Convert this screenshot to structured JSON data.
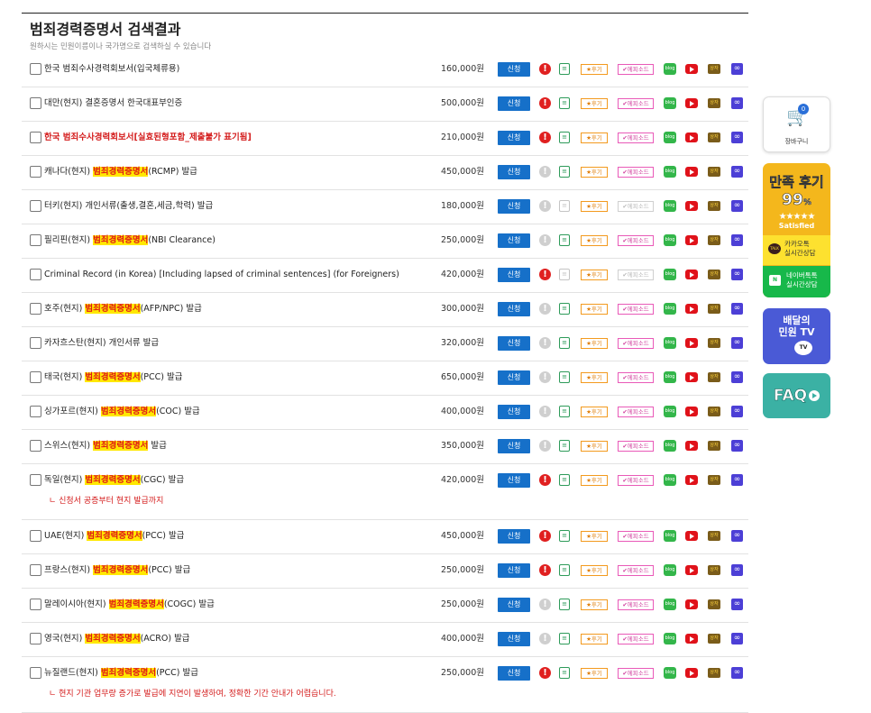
{
  "header": {
    "title": "범죄경력증명서 검색결과",
    "subtitle": "원하시는 민원이름이나 국가명으로 검색하실 수 있습니다"
  },
  "labels": {
    "apply": "신청",
    "review": "★후기",
    "episode": "✔에피소드",
    "blog": "blog",
    "box": "상자",
    "doc": "≡"
  },
  "rows": [
    {
      "pre": "한국 범죄수사경력회보서(입국체류용)",
      "hl": "",
      "post": "",
      "price": "160,000원",
      "red": false,
      "warn_on": true,
      "doc_on": true,
      "episode_on": true,
      "note": ""
    },
    {
      "pre": "대만(현지) 결혼증명서 한국대표부인증",
      "hl": "",
      "post": "",
      "price": "500,000원",
      "red": false,
      "warn_on": true,
      "doc_on": true,
      "episode_on": true,
      "note": ""
    },
    {
      "pre": "한국 범죄수사경력회보서[실효된형포함_제출불가 표기됨]",
      "hl": "",
      "post": "",
      "price": "210,000원",
      "red": true,
      "warn_on": true,
      "doc_on": true,
      "episode_on": true,
      "note": ""
    },
    {
      "pre": "캐나다(현지) ",
      "hl": "범죄경력증명서",
      "post": "(RCMP) 발급",
      "price": "450,000원",
      "red": false,
      "warn_on": false,
      "doc_on": true,
      "episode_on": true,
      "note": ""
    },
    {
      "pre": "터키(현지) 개인서류(출생,결혼,세금,학력) 발급",
      "hl": "",
      "post": "",
      "price": "180,000원",
      "red": false,
      "warn_on": false,
      "doc_on": false,
      "episode_on": false,
      "note": ""
    },
    {
      "pre": "필리핀(현지) ",
      "hl": "범죄경력증명서",
      "post": "(NBI Clearance)",
      "price": "250,000원",
      "red": false,
      "warn_on": false,
      "doc_on": true,
      "episode_on": true,
      "note": ""
    },
    {
      "pre": "Criminal Record (in Korea) [Including lapsed of criminal sentences] (for Foreigners)",
      "hl": "",
      "post": "",
      "price": "420,000원",
      "red": false,
      "warn_on": true,
      "doc_on": false,
      "episode_on": false,
      "note": ""
    },
    {
      "pre": "호주(현지) ",
      "hl": "범죄경력증명서",
      "post": "(AFP/NPC) 발급",
      "price": "300,000원",
      "red": false,
      "warn_on": false,
      "doc_on": true,
      "episode_on": true,
      "note": ""
    },
    {
      "pre": "카자흐스탄(현지) 개인서류 발급",
      "hl": "",
      "post": "",
      "price": "320,000원",
      "red": false,
      "warn_on": false,
      "doc_on": true,
      "episode_on": true,
      "note": ""
    },
    {
      "pre": "태국(현지) ",
      "hl": "범죄경력증명서",
      "post": "(PCC) 발급",
      "price": "650,000원",
      "red": false,
      "warn_on": false,
      "doc_on": true,
      "episode_on": true,
      "note": ""
    },
    {
      "pre": "싱가포르(현지) ",
      "hl": "범죄경력증명서",
      "post": "(COC) 발급",
      "price": "400,000원",
      "red": false,
      "warn_on": false,
      "doc_on": true,
      "episode_on": true,
      "note": ""
    },
    {
      "pre": "스위스(현지) ",
      "hl": "범죄경력증명서",
      "post": " 발급",
      "price": "350,000원",
      "red": false,
      "warn_on": false,
      "doc_on": true,
      "episode_on": true,
      "note": ""
    },
    {
      "pre": "독일(현지) ",
      "hl": "범죄경력증명서",
      "post": "(CGC) 발급",
      "price": "420,000원",
      "red": false,
      "warn_on": true,
      "doc_on": true,
      "episode_on": true,
      "note": "ㄴ 신청서 공증부터 현지 발급까지"
    },
    {
      "pre": "UAE(현지) ",
      "hl": "범죄경력증명서",
      "post": "(PCC) 발급",
      "price": "450,000원",
      "red": false,
      "warn_on": true,
      "doc_on": true,
      "episode_on": true,
      "note": ""
    },
    {
      "pre": "프랑스(현지) ",
      "hl": "범죄경력증명서",
      "post": "(PCC) 발급",
      "price": "250,000원",
      "red": false,
      "warn_on": true,
      "doc_on": true,
      "episode_on": true,
      "note": ""
    },
    {
      "pre": "말레이시아(현지) ",
      "hl": "범죄경력증명서",
      "post": "(COGC) 발급",
      "price": "250,000원",
      "red": false,
      "warn_on": false,
      "doc_on": true,
      "episode_on": true,
      "note": ""
    },
    {
      "pre": "영국(현지) ",
      "hl": "범죄경력증명서",
      "post": "(ACRO) 발급",
      "price": "400,000원",
      "red": false,
      "warn_on": false,
      "doc_on": true,
      "episode_on": true,
      "note": ""
    },
    {
      "pre": "뉴질랜드(현지) ",
      "hl": "범죄경력증명서",
      "post": "(PCC) 발급",
      "price": "250,000원",
      "red": false,
      "warn_on": true,
      "doc_on": true,
      "episode_on": true,
      "note": "ㄴ 현지 기관 업무량 증가로 발급에 지연이 발생하여, 정확한 기간 안내가 어렵습니다."
    }
  ],
  "side": {
    "cart_label": "장바구니",
    "cart_count": "0",
    "review_title": "만족 후기",
    "review_percent": "99",
    "review_percent_sign": "%",
    "review_stars": "★★★★★",
    "review_satisfied": "Satisfied",
    "kakao_icon": "TALK",
    "kakao_line1": "카카오톡",
    "kakao_line2": "실시간상담",
    "naver_icon": "N",
    "naver_line1": "네이버톡톡",
    "naver_line2": "실시간상담",
    "tv_line1": "배달의",
    "tv_line2": "민원 TV",
    "tv_badge": "TV",
    "faq": "FAQ"
  },
  "colors": {
    "apply_button": "#1670c9",
    "warn_active": "#e02020",
    "highlight_bg": "#ffe800",
    "highlight_text": "#e01818",
    "note_text": "#d41c1c"
  }
}
